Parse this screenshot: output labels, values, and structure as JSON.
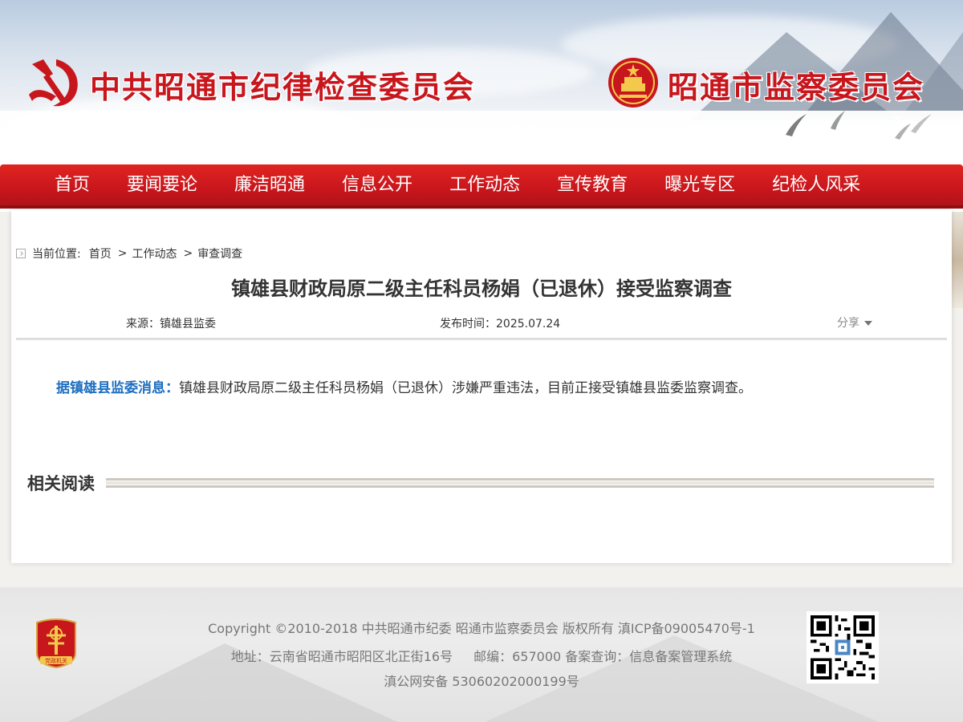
{
  "header": {
    "title_left": "中共昭通市纪律检查委员会",
    "title_right": "昭通市监察委员会"
  },
  "nav": {
    "items": [
      "首页",
      "要闻要论",
      "廉洁昭通",
      "信息公开",
      "工作动态",
      "宣传教育",
      "曝光专区",
      "纪检人风采"
    ]
  },
  "breadcrumb": {
    "label": "当前位置:",
    "items": [
      "首页",
      "工作动态",
      "审查调查"
    ],
    "separator": ">"
  },
  "article": {
    "title": "镇雄县财政局原二级主任科员杨娟（已退休）接受监察调查",
    "source": "来源：镇雄县监委",
    "date": "发布时间：2025.07.24",
    "share_label": "分享",
    "lead": "据镇雄县监委消息：",
    "body": "镇雄县财政局原二级主任科员杨娟（已退休）涉嫌严重违法，目前正接受镇雄县监委监察调查。"
  },
  "related": {
    "heading": "相关阅读"
  },
  "footer": {
    "copyright": "Copyright ©2010-2018 中共昭通市纪委 昭通市监察委员会 版权所有 滇ICP备09005470号-1",
    "address": "地址：云南省昭通市昭阳区北正街16号",
    "postcode": "邮编：657000 备案查询：信息备案管理系统",
    "police": "滇公网安备 53060202000199号",
    "badge_text": "党政机关"
  },
  "colors": {
    "brand_red": "#c8161d",
    "lead_blue": "#1e6fc0"
  },
  "icons": [
    "party-emblem-icon",
    "national-emblem-icon",
    "breadcrumb-home-icon",
    "chevron-down-icon",
    "party-government-badge-icon",
    "qr-code-icon"
  ]
}
